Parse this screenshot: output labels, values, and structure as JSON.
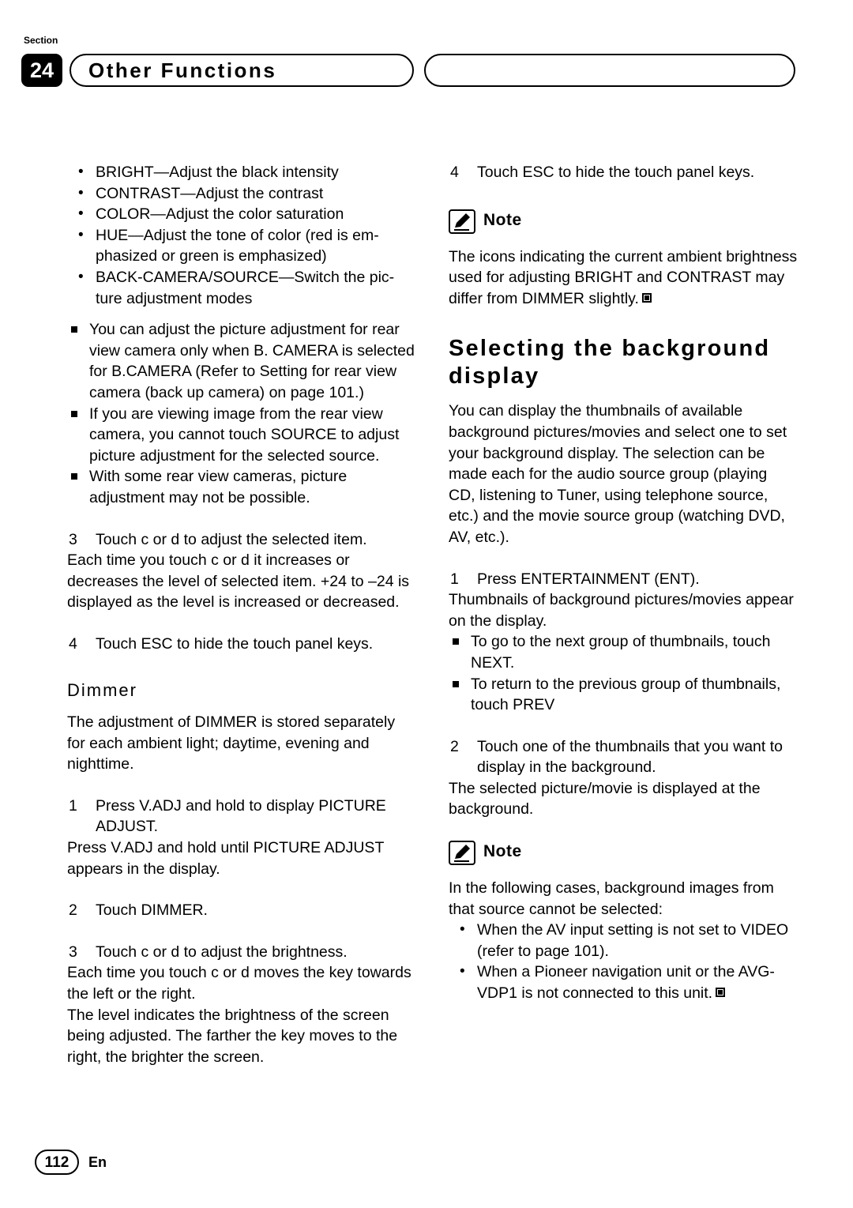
{
  "header": {
    "section_label": "Section",
    "section_number": "24",
    "chapter_title": "Other Functions"
  },
  "left_column": {
    "bullets": [
      "BRIGHT—Adjust the black intensity",
      "CONTRAST—Adjust the contrast",
      "COLOR—Adjust the color saturation",
      "HUE—Adjust the tone of color (red is em-phasized or green is emphasized)",
      "BACK-CAMERA/SOURCE—Switch the pic-ture adjustment modes"
    ],
    "notes": [
      "You can adjust the picture adjustment for rear view camera only when B. CAMERA is selected for B.CAMERA (Refer to Setting for rear view camera (back up camera) on page 101.)",
      "If you are viewing image from the rear view camera, you cannot touch SOURCE to adjust picture adjustment for the selected source.",
      "With some rear view cameras, picture adjustment may not be possible."
    ],
    "step3": {
      "num": "3",
      "text": "Touch c or d to adjust the selected item."
    },
    "step3_body": "Each time you touch c or d it increases or decreases the level of selected item. +24 to –24 is displayed as the level is increased or decreased.",
    "step4": {
      "num": "4",
      "text": "Touch ESC to hide the touch panel keys."
    },
    "dimmer_heading": "Dimmer",
    "dimmer_intro": "The adjustment of DIMMER is stored separately for each ambient light; daytime, evening and nighttime.",
    "dimmer_step1": {
      "num": "1",
      "text": "Press V.ADJ and hold to display PICTURE ADJUST."
    },
    "dimmer_step1_body": "Press V.ADJ and hold until PICTURE ADJUST appears in the display.",
    "dimmer_step2": {
      "num": "2",
      "text": "Touch DIMMER."
    },
    "dimmer_step3": {
      "num": "3",
      "text": "Touch c or d to adjust the brightness."
    },
    "dimmer_step3_body1": "Each time you touch c or d moves the key towards the left or the right.",
    "dimmer_step3_body2": "The level indicates the brightness of the screen being adjusted. The farther the key moves to the right, the brighter the screen."
  },
  "right_column": {
    "step4": {
      "num": "4",
      "text": "Touch ESC to hide the touch panel keys."
    },
    "note_label_1": "Note",
    "note_1": "The icons indicating the current ambient brightness used for adjusting BRIGHT and CONTRAST may differ from DIMMER slightly.",
    "heading": "Selecting the background display",
    "intro": "You can display the thumbnails of available background pictures/movies and select one to set your background display. The selection can be made each for the audio source group (playing CD, listening to Tuner, using telephone source, etc.) and the movie source group (watching DVD, AV, etc.).",
    "step1": {
      "num": "1",
      "text": "Press ENTERTAINMENT (ENT)."
    },
    "step1_body": "Thumbnails of background pictures/movies appear on the display.",
    "step1_notes": [
      "To go to the next group of thumbnails, touch NEXT.",
      "To return to the previous group of thumbnails, touch PREV"
    ],
    "step2": {
      "num": "2",
      "text": "Touch one of the thumbnails that you want to display in the background."
    },
    "step2_body": "The selected picture/movie is displayed at the background.",
    "note_label_2": "Note",
    "note_2_intro": "In the following cases, background images from that source cannot be selected:",
    "note_2_bullets": [
      "When the AV input setting is not set to VIDEO (refer to page 101).",
      "When a Pioneer navigation unit or the AVG-VDP1 is not connected to this unit."
    ]
  },
  "footer": {
    "page_number": "112",
    "language": "En"
  }
}
